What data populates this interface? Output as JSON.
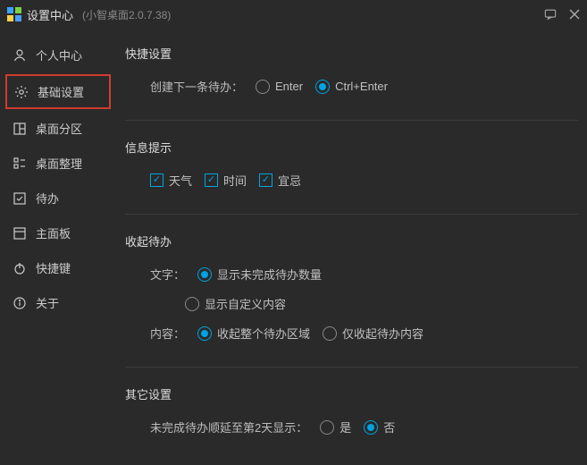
{
  "titlebar": {
    "main": "设置中心",
    "sub": "(小智桌面2.0.7.38)"
  },
  "sidebar": {
    "items": [
      {
        "label": "个人中心"
      },
      {
        "label": "基础设置"
      },
      {
        "label": "桌面分区"
      },
      {
        "label": "桌面整理"
      },
      {
        "label": "待办"
      },
      {
        "label": "主面板"
      },
      {
        "label": "快捷键"
      },
      {
        "label": "关于"
      }
    ]
  },
  "sections": {
    "quick": {
      "title": "快捷设置",
      "create_label": "创建下一条待办：",
      "opt1": "Enter",
      "opt2": "Ctrl+Enter"
    },
    "info": {
      "title": "信息提示",
      "weather": "天气",
      "time": "时间",
      "yi_ji": "宜忌"
    },
    "collapse": {
      "title": "收起待办",
      "text_label": "文字：",
      "text_opt1": "显示未完成待办数量",
      "text_opt2": "显示自定义内容",
      "content_label": "内容：",
      "content_opt1": "收起整个待办区域",
      "content_opt2": "仅收起待办内容"
    },
    "other": {
      "title": "其它设置",
      "delay_label": "未完成待办顺延至第2天显示：",
      "yes": "是",
      "no": "否"
    }
  }
}
